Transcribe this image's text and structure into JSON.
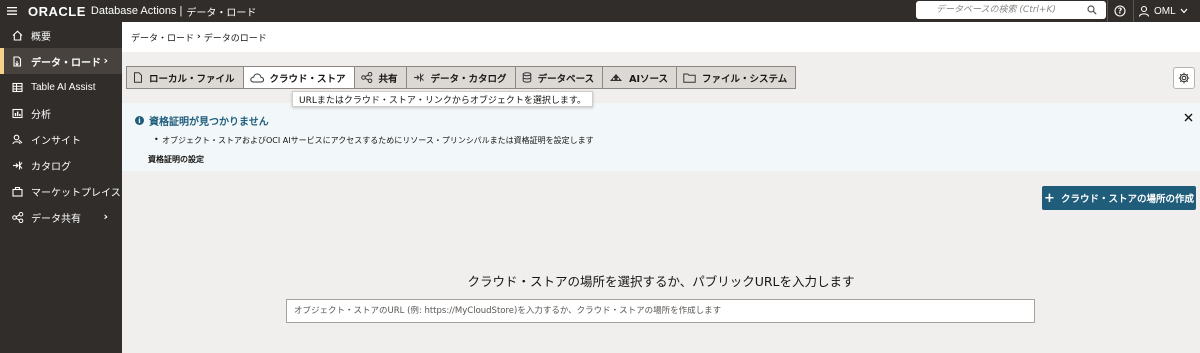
{
  "header": {
    "brand": "ORACLE",
    "app_name": "Database Actions |",
    "page_name": "データ・ロード",
    "search_placeholder": "データベースの検索 (Ctrl+K)",
    "user_name": "OML"
  },
  "sidebar": {
    "items": [
      {
        "label": "概要",
        "icon": "home-icon"
      },
      {
        "label": "データ・ロード",
        "icon": "data-load-icon",
        "active": true
      },
      {
        "label": "Table AI Assist",
        "icon": "table-icon"
      },
      {
        "label": "分析",
        "icon": "analysis-icon"
      },
      {
        "label": "インサイト",
        "icon": "insight-icon"
      },
      {
        "label": "カタログ",
        "icon": "catalog-icon"
      },
      {
        "label": "マーケットプレイス",
        "icon": "marketplace-icon"
      },
      {
        "label": "データ共有",
        "icon": "data-share-icon"
      }
    ]
  },
  "breadcrumb": {
    "parent": "データ・ロード",
    "separator": "›",
    "current": "データのロード"
  },
  "tabs": [
    {
      "label": "ローカル・ファイル",
      "icon": "file-icon"
    },
    {
      "label": "クラウド・ストア",
      "icon": "cloud-icon",
      "selected": true
    },
    {
      "label": "共有",
      "icon": "share-icon"
    },
    {
      "label": "データ・カタログ",
      "icon": "catalog-icon"
    },
    {
      "label": "データベース",
      "icon": "database-icon"
    },
    {
      "label": "AIソース",
      "icon": "ai-source-icon"
    },
    {
      "label": "ファイル・システム",
      "icon": "folder-icon"
    }
  ],
  "tooltip": "URLまたはクラウド・ストア・リンクからオブジェクトを選択します。",
  "notice": {
    "title": "資格証明が見つかりません",
    "bullet": "オブジェクト・ストアおよびOCI AIサービスにアクセスするためにリソース・プリンシパルまたは資格証明を設定します",
    "link": "資格証明の設定"
  },
  "create_button": "クラウド・ストアの場所の作成",
  "prompt": "クラウド・ストアの場所を選択するか、パブリックURLを入力します",
  "url_input_placeholder": "オブジェクト・ストアのURL (例: https://MyCloudStore)を入力するか、クラウド・ストアの場所を作成します",
  "colors": {
    "header_bg": "#312d2a",
    "accent": "#1f5d7b",
    "active_marker": "#f5d28a"
  }
}
